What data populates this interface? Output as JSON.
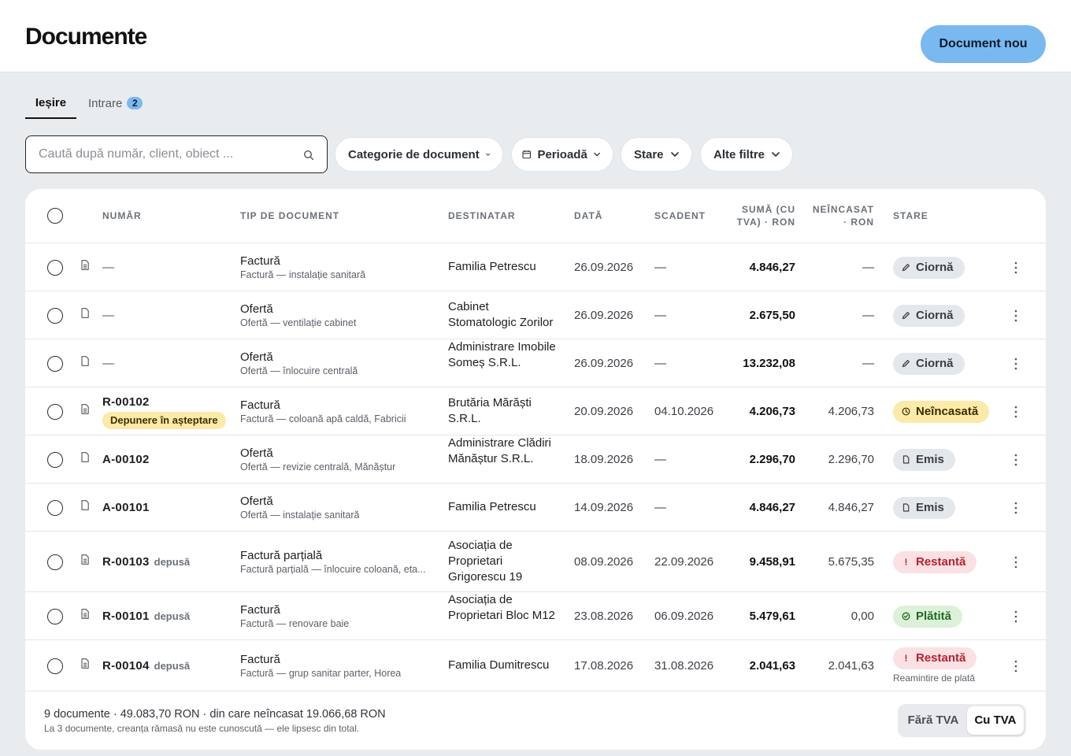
{
  "header": {
    "title": "Documente",
    "new_button": "Document nou"
  },
  "tabs": [
    {
      "label": "Ieșire",
      "active": true
    },
    {
      "label": "Intrare",
      "badge": "2",
      "active": false
    }
  ],
  "search": {
    "placeholder": "Caută după număr, client, obiect ..."
  },
  "filters": {
    "category": "Categorie de document",
    "period": "Perioadă",
    "state": "Stare",
    "more": "Alte filtre"
  },
  "table": {
    "headers": {
      "number": "NUMĂR",
      "type": "TIP DE DOCUMENT",
      "recipient": "DESTINATAR",
      "date": "DATĂ",
      "due": "SCADENT",
      "sum_l1": "SUMĂ (CU",
      "sum_l2": "TVA) · RON",
      "unpaid_l1": "NEÎNCASAT",
      "unpaid_l2": "· RON",
      "status": "STARE"
    },
    "rows": [
      {
        "number": "—",
        "deposited": "",
        "pending": "",
        "type": "Factură",
        "subtitle": "Factură — instalație sanitară",
        "recipient": "Familia Petrescu",
        "date": "26.09.2026",
        "due": "—",
        "sum": "4.846,27",
        "unpaid": "—",
        "status": "Ciornă",
        "status_kind": "draft",
        "icon": "invoice-icon"
      },
      {
        "number": "—",
        "deposited": "",
        "pending": "",
        "type": "Ofertă",
        "subtitle": "Ofertă — ventilație cabinet",
        "recipient": "Cabinet Stomatologic Zorilor",
        "date": "26.09.2026",
        "due": "—",
        "sum": "2.675,50",
        "unpaid": "—",
        "status": "Ciornă",
        "status_kind": "draft",
        "icon": "document-icon"
      },
      {
        "number": "—",
        "deposited": "",
        "pending": "",
        "type": "Ofertă",
        "subtitle": "Ofertă — înlocuire centrală",
        "recipient": "Administrare Imobile Someș S.R.L.",
        "date": "26.09.2026",
        "due": "—",
        "sum": "13.232,08",
        "unpaid": "—",
        "status": "Ciornă",
        "status_kind": "draft",
        "icon": "document-icon"
      },
      {
        "number": "R-00102",
        "deposited": "",
        "pending": "Depunere în așteptare",
        "type": "Factură",
        "subtitle": "Factură — coloană apă caldă, Fabricii",
        "recipient": "Brutăria Mărăști S.R.L.",
        "date": "20.09.2026",
        "due": "04.10.2026",
        "sum": "4.206,73",
        "unpaid": "4.206,73",
        "status": "Neîncasată",
        "status_kind": "unpaid",
        "icon": "invoice-icon"
      },
      {
        "number": "A-00102",
        "deposited": "",
        "pending": "",
        "type": "Ofertă",
        "subtitle": "Ofertă — revizie centrală, Mănăștur",
        "recipient": "Administrare Clădiri Mănăștur S.R.L.",
        "date": "18.09.2026",
        "due": "—",
        "sum": "2.296,70",
        "unpaid": "2.296,70",
        "status": "Emis",
        "status_kind": "issued",
        "icon": "document-icon"
      },
      {
        "number": "A-00101",
        "deposited": "",
        "pending": "",
        "type": "Ofertă",
        "subtitle": "Ofertă — instalație sanitară",
        "recipient": "Familia Petrescu",
        "date": "14.09.2026",
        "due": "—",
        "sum": "4.846,27",
        "unpaid": "4.846,27",
        "status": "Emis",
        "status_kind": "issued",
        "icon": "document-icon"
      },
      {
        "number": "R-00103",
        "deposited": "depusă",
        "pending": "",
        "type": "Factură parțială",
        "subtitle": "Factură parțială — înlocuire coloană, eta...",
        "recipient": "Asociația de Proprietari Grigorescu 19",
        "date": "08.09.2026",
        "due": "22.09.2026",
        "sum": "9.458,91",
        "unpaid": "5.675,35",
        "status": "Restantă",
        "status_kind": "overdue",
        "icon": "invoice-icon"
      },
      {
        "number": "R-00101",
        "deposited": "depusă",
        "pending": "",
        "type": "Factură",
        "subtitle": "Factură — renovare baie",
        "recipient": "Asociația de Proprietari Bloc M12",
        "date": "23.08.2026",
        "due": "06.09.2026",
        "sum": "5.479,61",
        "unpaid": "0,00",
        "status": "Plătită",
        "status_kind": "paid",
        "icon": "invoice-icon"
      },
      {
        "number": "R-00104",
        "deposited": "depusă",
        "pending": "",
        "type": "Factură",
        "subtitle": "Factură — grup sanitar parter, Horea",
        "recipient": "Familia Dumitrescu",
        "date": "17.08.2026",
        "due": "31.08.2026",
        "sum": "2.041,63",
        "unpaid": "2.041,63",
        "status": "Restantă",
        "status_kind": "overdue",
        "reminder": "Reamintire de plată",
        "icon": "invoice-icon"
      }
    ]
  },
  "footer": {
    "summary": "9 documente · 49.083,70 RON · din care neîncasat 19.066,68 RON",
    "note": "La 3 documente, creanța rămasă nu este cunoscută — ele lipsesc din total.",
    "vat_off": "Fără TVA",
    "vat_on": "Cu TVA",
    "vat_selected": "Cu TVA"
  },
  "colors": {
    "accent": "#7ab8f0",
    "draft": "#e4e7eb",
    "unpaid": "#fbeaa8",
    "overdue": "#fbe1e3",
    "paid": "#dcf1d8"
  }
}
